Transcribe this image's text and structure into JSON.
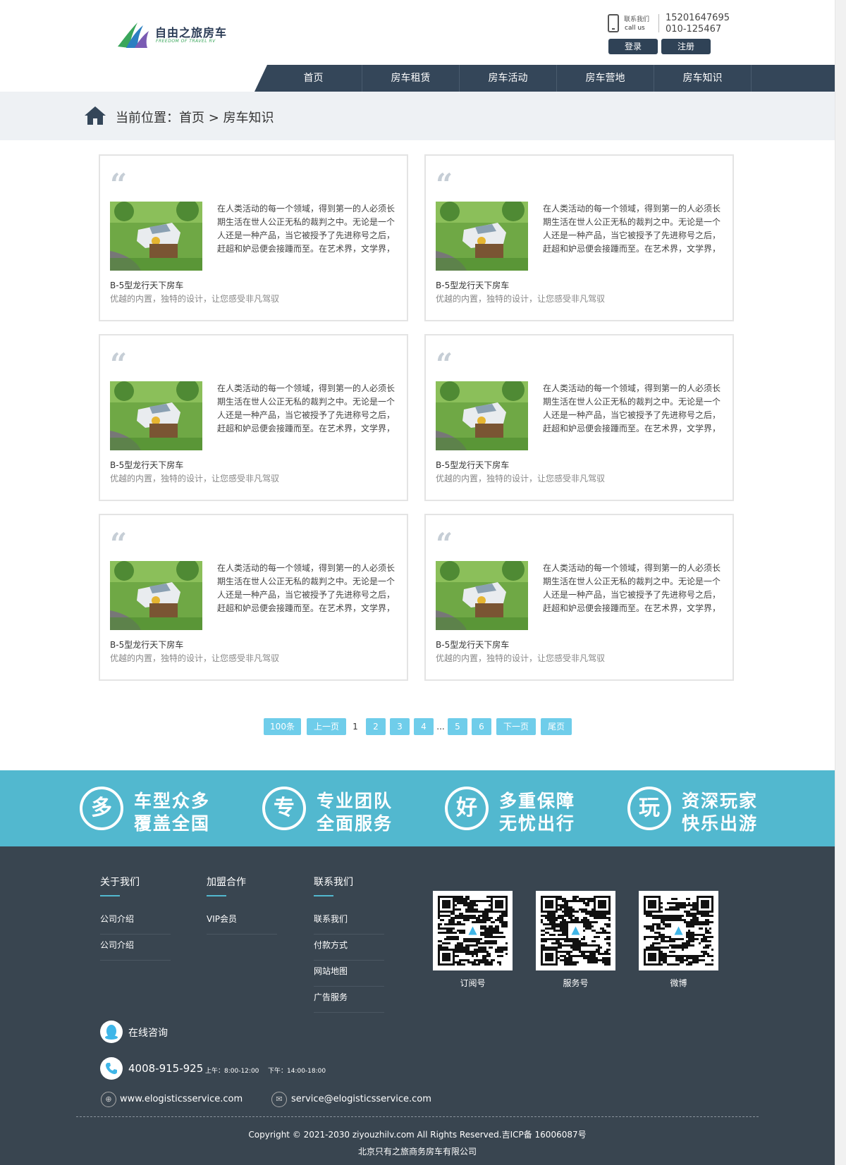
{
  "header": {
    "logo_text": "自由之旅房车",
    "logo_sub": "FREEDOM OF TRAVEL RV",
    "contact_cn": "联系我们",
    "contact_en": "call us",
    "phone1": "15201647695",
    "phone2": "010-125467",
    "login_label": "登录",
    "register_label": "注册"
  },
  "nav": {
    "items": [
      "首页",
      "房车租赁",
      "房车活动",
      "房车营地",
      "房车知识"
    ]
  },
  "breadcrumb": {
    "text": "当前位置：首页 > 房车知识"
  },
  "cards": [
    {
      "excerpt": "在人类活动的每一个领域，得到第一的人必须长期生活在世人公正无私的裁判之中。无论是一个人还是一种产品，当它被授予了先进称号之后，赶超和妒忌便会接踵而至。在艺术界，文学界，",
      "title": "B-5型龙行天下房车",
      "sub": "优越的内置，独特的设计，让您感受非凡驾驭"
    },
    {
      "excerpt": "在人类活动的每一个领域，得到第一的人必须长期生活在世人公正无私的裁判之中。无论是一个人还是一种产品，当它被授予了先进称号之后，赶超和妒忌便会接踵而至。在艺术界，文学界，",
      "title": "B-5型龙行天下房车",
      "sub": "优越的内置，独特的设计，让您感受非凡驾驭"
    },
    {
      "excerpt": "在人类活动的每一个领域，得到第一的人必须长期生活在世人公正无私的裁判之中。无论是一个人还是一种产品，当它被授予了先进称号之后，赶超和妒忌便会接踵而至。在艺术界，文学界，",
      "title": "B-5型龙行天下房车",
      "sub": "优越的内置，独特的设计，让您感受非凡驾驭"
    },
    {
      "excerpt": "在人类活动的每一个领域，得到第一的人必须长期生活在世人公正无私的裁判之中。无论是一个人还是一种产品，当它被授予了先进称号之后，赶超和妒忌便会接踵而至。在艺术界，文学界，",
      "title": "B-5型龙行天下房车",
      "sub": "优越的内置，独特的设计，让您感受非凡驾驭"
    },
    {
      "excerpt": "在人类活动的每一个领域，得到第一的人必须长期生活在世人公正无私的裁判之中。无论是一个人还是一种产品，当它被授予了先进称号之后，赶超和妒忌便会接踵而至。在艺术界，文学界，",
      "title": "B-5型龙行天下房车",
      "sub": "优越的内置，独特的设计，让您感受非凡驾驭"
    },
    {
      "excerpt": "在人类活动的每一个领域，得到第一的人必须长期生活在世人公正无私的裁判之中。无论是一个人还是一种产品，当它被授予了先进称号之后，赶超和妒忌便会接踵而至。在艺术界，文学界，",
      "title": "B-5型龙行天下房车",
      "sub": "优越的内置，独特的设计，让您感受非凡驾驭"
    }
  ],
  "pagination": {
    "total": "100条",
    "prev": "上一页",
    "current": "1",
    "pages": [
      "2",
      "3",
      "4"
    ],
    "ellipsis": "...",
    "pages_after": [
      "5",
      "6"
    ],
    "next": "下一页",
    "last": "尾页"
  },
  "features": [
    {
      "icon_char": "多",
      "line1": "车型众多",
      "line2": "覆盖全国"
    },
    {
      "icon_char": "专",
      "line1": "专业团队",
      "line2": "全面服务"
    },
    {
      "icon_char": "好",
      "line1": "多重保障",
      "line2": "无忧出行"
    },
    {
      "icon_char": "玩",
      "line1": "资深玩家",
      "line2": "快乐出游"
    }
  ],
  "footer": {
    "columns": [
      {
        "title": "关于我们",
        "links": [
          "公司介绍",
          "公司介绍"
        ]
      },
      {
        "title": "加盟合作",
        "links": [
          "VIP会员"
        ]
      },
      {
        "title": "联系我们",
        "links": [
          "联系我们",
          "付款方式",
          "网站地图",
          "广告服务"
        ]
      }
    ],
    "qr_codes": [
      {
        "label": "订阅号"
      },
      {
        "label": "服务号"
      },
      {
        "label": "微博"
      }
    ],
    "online_consult": "在线咨询",
    "hotline": "4008-915-925",
    "hours_am": "上午：8:00-12:00",
    "hours_pm": "下午：14:00-18:00",
    "website": "www.elogisticsservice.com",
    "email": "service@elogisticsservice.com",
    "copyright": "Copyright © 2021-2030 ziyouzhilv.com All Rights Reserved.吉ICP备 16006087号",
    "company": "北京只有之旅商务房车有限公司"
  },
  "colors": {
    "nav_bg": "#344659",
    "accent_blue": "#52b8cf",
    "pager_blue": "#6fcdea",
    "footer_bg": "#394550"
  }
}
